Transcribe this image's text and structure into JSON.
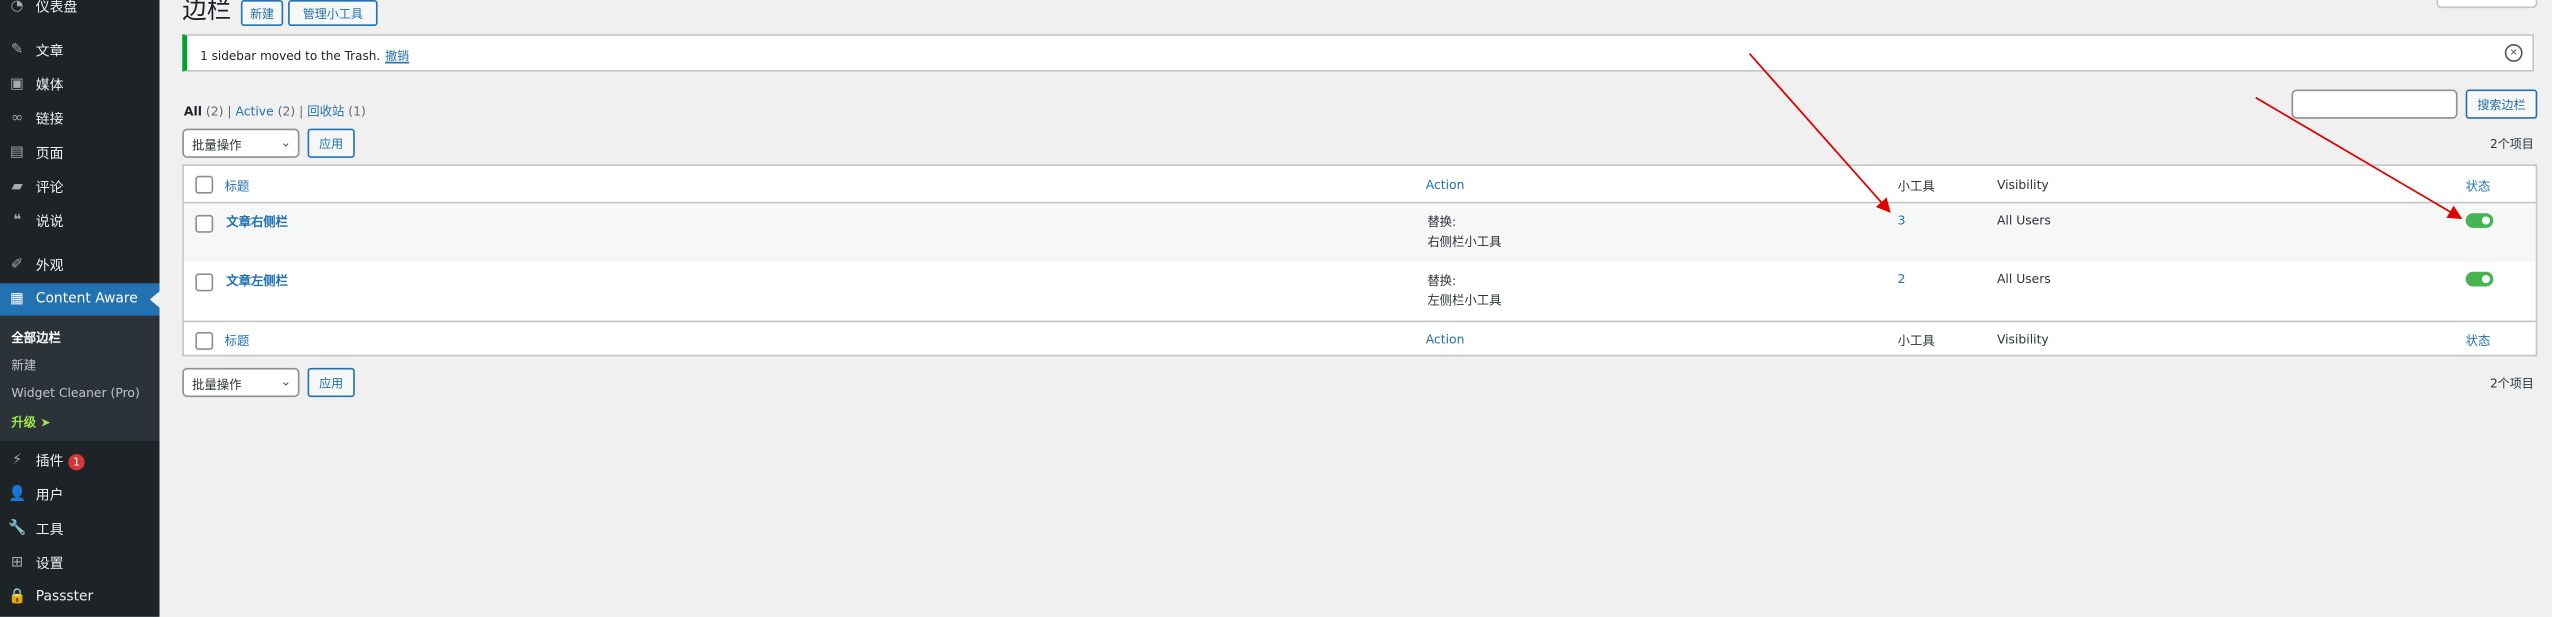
{
  "sidebar": {
    "items": [
      {
        "key": "dashboard",
        "label": "仪表盘",
        "icon": "dashboard-icon"
      },
      {
        "key": "posts",
        "label": "文章",
        "icon": "pin-icon"
      },
      {
        "key": "media",
        "label": "媒体",
        "icon": "media-icon"
      },
      {
        "key": "links",
        "label": "链接",
        "icon": "link-icon"
      },
      {
        "key": "pages",
        "label": "页面",
        "icon": "page-icon"
      },
      {
        "key": "comments",
        "label": "评论",
        "icon": "comment-icon"
      },
      {
        "key": "talk",
        "label": "说说",
        "icon": "quote-icon"
      },
      {
        "key": "appearance",
        "label": "外观",
        "icon": "brush-icon"
      },
      {
        "key": "content-aware",
        "label": "Content Aware",
        "icon": "layout-icon"
      },
      {
        "key": "plugins",
        "label": "插件",
        "icon": "plugin-icon",
        "badge": "1"
      },
      {
        "key": "users",
        "label": "用户",
        "icon": "user-icon"
      },
      {
        "key": "tools",
        "label": "工具",
        "icon": "wrench-icon"
      },
      {
        "key": "settings",
        "label": "设置",
        "icon": "settings-icon"
      },
      {
        "key": "passster",
        "label": "Passster",
        "icon": "lock-icon"
      }
    ],
    "submenu": [
      {
        "label": "全部边栏"
      },
      {
        "label": "新建"
      },
      {
        "label": "Widget Cleaner (Pro)"
      },
      {
        "label": "升级 ➤"
      }
    ]
  },
  "header": {
    "title": "边栏",
    "new_label": "新建",
    "manage_label": "管理小工具"
  },
  "notice": {
    "message": "1 sidebar moved to the Trash.",
    "undo": "撤销"
  },
  "views": {
    "all": "All",
    "all_count": "(2)",
    "active": "Active",
    "active_count": "(2)",
    "trash": "回收站",
    "trash_count": "(1)",
    "sep": "|"
  },
  "bulk": {
    "select_value": "批量操作",
    "apply": "应用"
  },
  "search": {
    "button": "搜索边栏",
    "value": ""
  },
  "item_count": "2个项目",
  "table": {
    "columns": {
      "title": "标题",
      "action": "Action",
      "widgets": "小工具",
      "visibility": "Visibility",
      "status": "状态"
    },
    "rows": [
      {
        "title": "文章右侧栏",
        "action_line1": "替换:",
        "action_line2": "右侧栏小工具",
        "widgets": "3",
        "visibility": "All Users",
        "status_on": true
      },
      {
        "title": "文章左侧栏",
        "action_line1": "替换:",
        "action_line2": "左侧栏小工具",
        "widgets": "2",
        "visibility": "All Users",
        "status_on": true
      }
    ]
  },
  "colors": {
    "sidebar_bg": "#1d2327",
    "accent": "#2271b1",
    "toggle_on": "#46b450",
    "notice_border": "#00a32a",
    "annotation_arrow": "#e00000"
  }
}
